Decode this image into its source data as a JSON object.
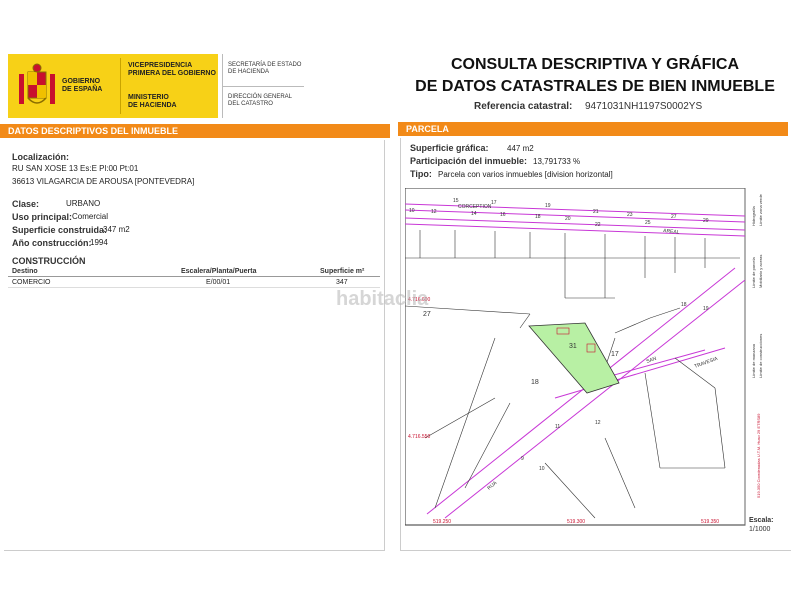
{
  "header": {
    "gobierno": "GOBIERNO\nDE ESPAÑA",
    "vicepresidencia": "VICEPRESIDENCIA\nPRIMERA DEL GOBIERNO",
    "ministerio": "MINISTERIO\nDE HACIENDA",
    "secretaria": "SECRETARÍA DE ESTADO\nDE HACIENDA",
    "direccion": "DIRECCIÓN GENERAL\nDEL CATASTRO",
    "title_line1": "CONSULTA DESCRIPTIVA Y GRÁFICA",
    "title_line2": "DE DATOS CATASTRALES DE BIEN INMUEBLE",
    "ref_label": "Referencia catastral:",
    "ref_value": "9471031NH1197S0002YS",
    "brand_color": "#f7d117",
    "accent_color": "#f28a18"
  },
  "left": {
    "section_title": "DATOS DESCRIPTIVOS DEL INMUEBLE",
    "localizacion_label": "Localización:",
    "localizacion_line1": "RU SAN XOSE 13 Es:E Pl:00 Pt:01",
    "localizacion_line2": "36613 VILAGARCIA DE AROUSA [PONTEVEDRA]",
    "clase_label": "Clase:",
    "clase_value": "URBANO",
    "uso_label": "Uso principal:",
    "uso_value": "Comercial",
    "superficie_label": "Superficie construida:",
    "superficie_value": "347 m2",
    "anio_label": "Año construcción:",
    "anio_value": "1994",
    "construccion_title": "CONSTRUCCIÓN",
    "table": {
      "headers": [
        "Destino",
        "Escalera/Planta/Puerta",
        "Superficie m²"
      ],
      "rows": [
        [
          "COMERCIO",
          "E/00/01",
          "347"
        ]
      ]
    }
  },
  "right": {
    "section_title": "PARCELA",
    "sup_grafica_label": "Superficie gráfica:",
    "sup_grafica_value": "447 m2",
    "participacion_label": "Participación del inmueble:",
    "participacion_value": "13,791733 %",
    "tipo_label": "Tipo:",
    "tipo_value": "Parcela con varios inmuebles [division horizontal]",
    "escala_label": "Escala:",
    "escala_value": "1/1000",
    "map": {
      "street_top": "CORCEPTION",
      "street_right": "AREAL",
      "street_mid": "SAN",
      "street_east": "TRAVESIA",
      "street_low": "RUA",
      "parcel_numbers": [
        "27",
        "31",
        "17",
        "18"
      ],
      "coord_y1": "4.716.600",
      "coord_y2": "4.716.550",
      "coord_x1": "519.250",
      "coord_x2": "519.300",
      "coord_x3": "519.350",
      "top_numbers": [
        "10",
        "12",
        "14",
        "15",
        "17",
        "16",
        "19",
        "18",
        "21",
        "20",
        "22",
        "27",
        "25",
        "29",
        "23"
      ],
      "diag_numbers": [
        "19",
        "18",
        "11",
        "12",
        "9",
        "10"
      ],
      "legend": [
        "Límite de parcela",
        "Mobiliario y aceras",
        "Hidrografía",
        "Límite zona verde",
        "Límite de manzana",
        "Límite de construcciones"
      ],
      "utm_note": "519.350 Coordenadas U.T.M. Huso 29 ETRS89",
      "watermark": "habitaclia",
      "parcel_color": "#b8f0a4",
      "line_color": "#c837d6"
    }
  }
}
